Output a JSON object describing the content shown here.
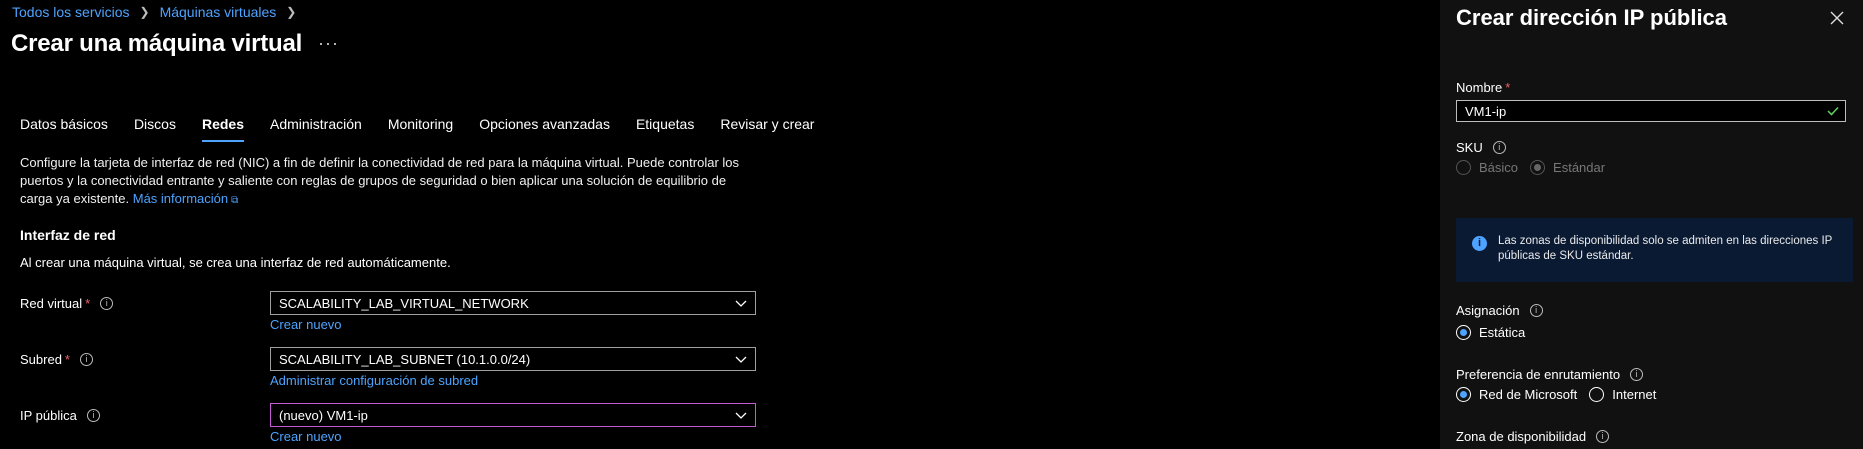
{
  "breadcrumb": {
    "items": [
      "Todos los servicios",
      "Máquinas virtuales"
    ]
  },
  "page": {
    "title": "Crear una máquina virtual",
    "more": "···"
  },
  "tabs": [
    "Datos básicos",
    "Discos",
    "Redes",
    "Administración",
    "Monitoring",
    "Opciones avanzadas",
    "Etiquetas",
    "Revisar y crear"
  ],
  "active_tab": "Redes",
  "intro": {
    "text": "Configure la tarjeta de interfaz de red (NIC) a fin de definir la conectividad de red para la máquina virtual. Puede controlar los puertos y la conectividad entrante y saliente con reglas de grupos de seguridad o bien aplicar una solución de equilibrio de carga ya existente.",
    "link": "Más información"
  },
  "section": {
    "title": "Interfaz de red",
    "desc": "Al crear una máquina virtual, se crea una interfaz de red automáticamente."
  },
  "fields": {
    "vnet": {
      "label": "Red virtual",
      "value": "SCALABILITY_LAB_VIRTUAL_NETWORK",
      "link": "Crear nuevo"
    },
    "subnet": {
      "label": "Subred",
      "value": "SCALABILITY_LAB_SUBNET (10.1.0.0/24)",
      "link": "Administrar configuración de subred"
    },
    "public_ip": {
      "label": "IP pública",
      "value": "(nuevo) VM1-ip",
      "link": "Crear nuevo"
    }
  },
  "panel": {
    "title": "Crear dirección IP pública",
    "name_label": "Nombre",
    "name_value": "VM1-ip",
    "sku_label": "SKU",
    "sku_options": [
      "Básico",
      "Estándar"
    ],
    "sku_selected": "Estándar",
    "info_text": "Las zonas de disponibilidad solo se admiten en las direcciones IP públicas de SKU estándar.",
    "assignment_label": "Asignación",
    "assignment_options": [
      "Estática"
    ],
    "routing_label": "Preferencia de enrutamiento",
    "routing_options": [
      "Red de Microsoft",
      "Internet"
    ],
    "routing_selected": "Red de Microsoft",
    "zone_label": "Zona de disponibilidad"
  },
  "colors": {
    "accent": "#4da3ff",
    "required": "#f16161",
    "focus": "#c55bd4",
    "info_bg": "#0a1a33"
  }
}
